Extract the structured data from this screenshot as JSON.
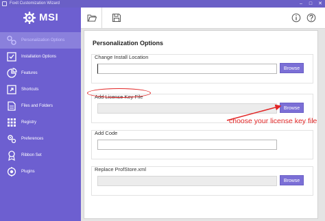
{
  "window": {
    "title": "Foxit Customization Wizard",
    "controls": [
      "minimize-icon",
      "maximize-icon",
      "close-icon"
    ]
  },
  "brand": {
    "logo_text": "MSI",
    "logo_icon": "gear-wrench-icon",
    "accent": "#6d5fd0"
  },
  "sidebar": {
    "items": [
      {
        "label": "Personalization Options",
        "icon": "personalization-icon",
        "active": true
      },
      {
        "label": "Installation Options",
        "icon": "installation-icon",
        "active": false
      },
      {
        "label": "Features",
        "icon": "features-icon",
        "active": false
      },
      {
        "label": "Shortcuts",
        "icon": "shortcuts-icon",
        "active": false
      },
      {
        "label": "Files and Folders",
        "icon": "files-folders-icon",
        "active": false
      },
      {
        "label": "Registry",
        "icon": "registry-icon",
        "active": false
      },
      {
        "label": "Preferences",
        "icon": "preferences-icon",
        "active": false
      },
      {
        "label": "Ribbon Set",
        "icon": "ribbon-icon",
        "active": false
      },
      {
        "label": "Plugins",
        "icon": "plugins-icon",
        "active": false
      }
    ]
  },
  "toolbar": {
    "open_icon": "folder-open-icon",
    "save_icon": "save-icon",
    "info_icon": "info-icon",
    "help_icon": "help-icon"
  },
  "main": {
    "title": "Personalization Options",
    "groups": [
      {
        "label": "Change Install Location",
        "value": "",
        "enabled": true,
        "button": "Browse"
      },
      {
        "label": "Add License Key File",
        "value": "",
        "enabled": false,
        "button": "Browse"
      },
      {
        "label": "Add Code",
        "value": "",
        "enabled": true,
        "button": ""
      },
      {
        "label": "Replace ProfStore.xml",
        "value": "",
        "enabled": false,
        "button": "Browse"
      }
    ]
  },
  "annotation": {
    "text": "choose your license key file",
    "color": "#e22626"
  }
}
